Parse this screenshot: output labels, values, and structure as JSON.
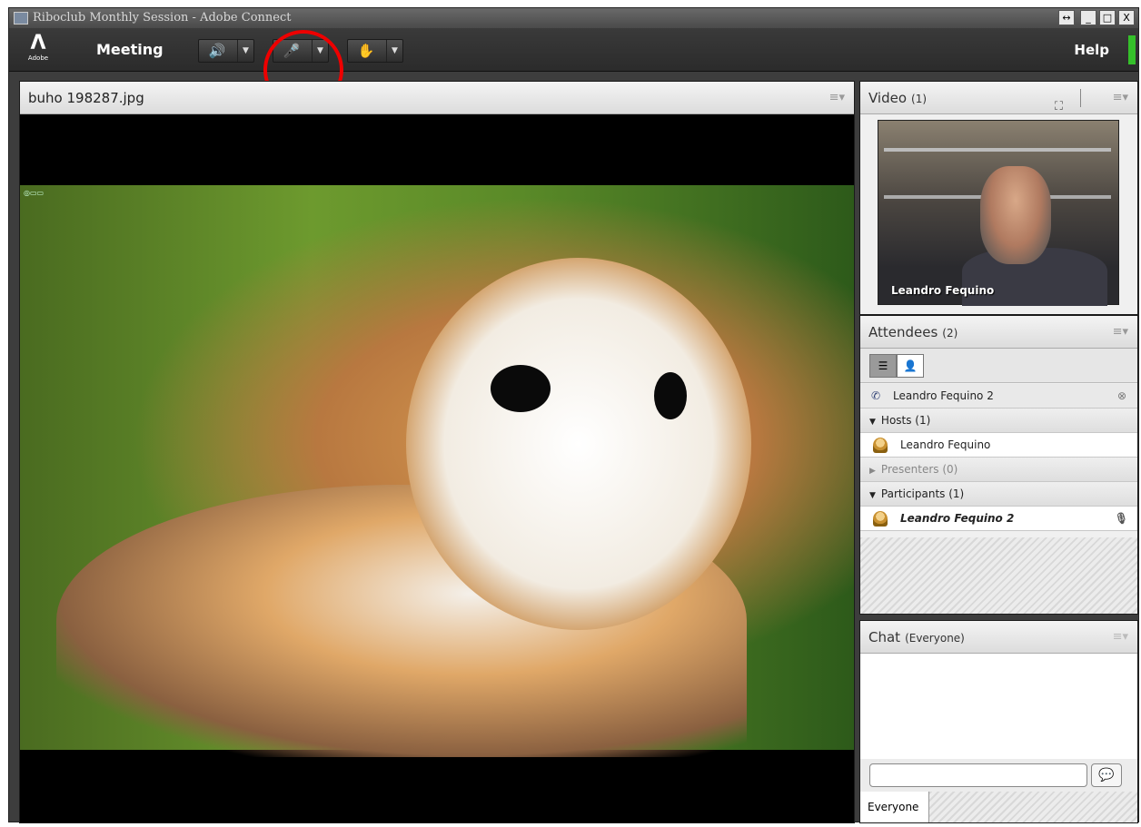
{
  "window": {
    "title": "Riboclub Monthly Session - Adobe Connect",
    "controls": [
      "↔",
      "_",
      "□",
      "X"
    ]
  },
  "menubar": {
    "logo_text": "Adobe",
    "meeting_label": "Meeting",
    "help_label": "Help"
  },
  "share_pod": {
    "title": "buho 198287.jpg"
  },
  "video_pod": {
    "title": "Video",
    "count": "(1)",
    "participant_name": "Leandro Fequino"
  },
  "attendees_pod": {
    "title": "Attendees",
    "count": "(2)",
    "current_user": "Leandro Fequino 2",
    "sections": {
      "hosts": "Hosts (1)",
      "presenters": "Presenters (0)",
      "participants": "Participants (1)"
    },
    "host_name": "Leandro Fequino",
    "participant_name": "Leandro Fequino 2"
  },
  "chat_pod": {
    "title": "Chat",
    "scope": "(Everyone)",
    "input_value": "",
    "tab_label": "Everyone"
  },
  "colors": {
    "accent_green": "#7ed320",
    "highlight_circle": "#e00000"
  }
}
